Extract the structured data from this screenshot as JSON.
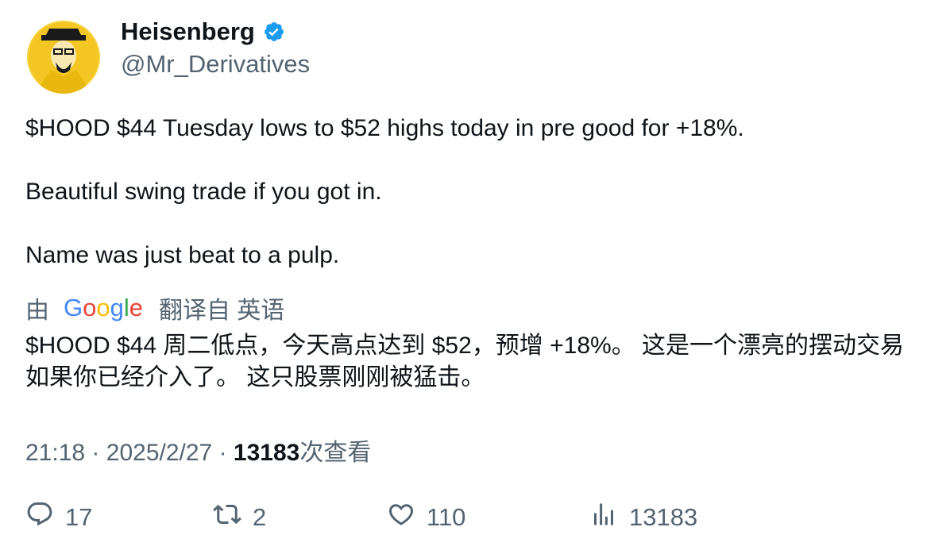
{
  "author": {
    "name": "Heisenberg",
    "handle": "@Mr_Derivatives",
    "verified_color": "#1d9bf0"
  },
  "tweet": {
    "lines": [
      "$HOOD $44 Tuesday lows to $52 highs today in pre good for +18%.",
      "Beautiful swing trade if you got in.",
      "Name was just beat to a pulp."
    ]
  },
  "translation": {
    "by_label": "由",
    "provider_letters": [
      "G",
      "o",
      "o",
      "g",
      "l",
      "e"
    ],
    "from_label": "翻译自 英语",
    "text": "$HOOD $44 周二低点，今天高点达到 $52，预增 +18%。 这是一个漂亮的摆动交易如果你已经介入了。 这只股票刚刚被猛击。"
  },
  "meta": {
    "time": "21:18",
    "sep": "·",
    "date": "2025/2/27",
    "views_count": "13183",
    "views_label": "次查看"
  },
  "actions": {
    "reply_count": "17",
    "retweet_count": "2",
    "like_count": "110",
    "views_count": "13183"
  },
  "icons": {
    "reply": "reply-icon",
    "retweet": "retweet-icon",
    "like": "heart-icon",
    "views": "analytics-icon",
    "verified": "verified-badge-icon"
  }
}
